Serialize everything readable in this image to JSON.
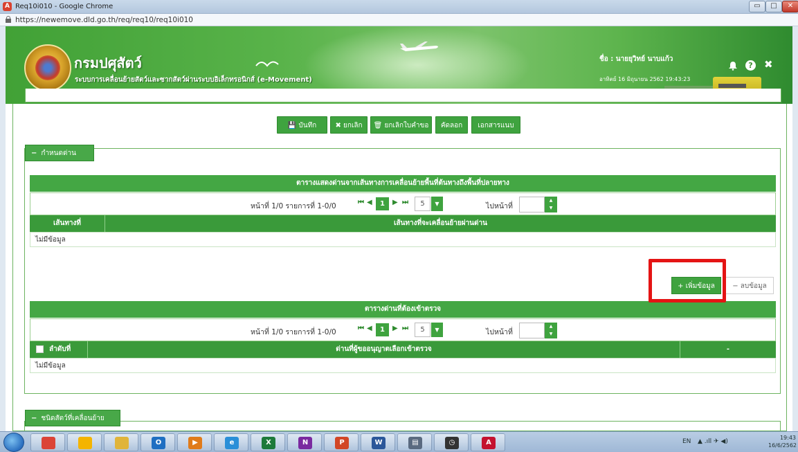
{
  "window": {
    "title": "Req10i010 - Google Chrome",
    "app_icon": "A",
    "controls": {
      "minimize": "▭",
      "maximize": "□",
      "close": "✕"
    }
  },
  "address_bar": {
    "url": "https://newemove.dld.go.th/req/req10/req10i010"
  },
  "header": {
    "title": "กรมปศุสัตว์",
    "subtitle": "ระบบการเคลื่อนย้ายสัตว์และซากสัตว์ผ่านระบบอิเล็กทรอนิกส์ (e-Movement)",
    "user_name": "ชื่อ : นายยุวิทย์ นาบแก้ว",
    "datetime": "อาทิตย์ 16 มิถุนายน 2562 19:43:23",
    "help_label": "?",
    "close_label": "✖"
  },
  "toolbar": {
    "save": "บันทึก",
    "cancel": "ยกเลิก",
    "cancel_request": "ยกเลิกใบคำขอ",
    "copy": "คัดลอก",
    "attachments": "เอกสารแนบ",
    "save_icon": "💾",
    "cancel_icon": "✖",
    "cancel_request_icon": "🗑"
  },
  "section_checkpoint": {
    "legend": "กำหนดด่าน",
    "toggle": "−",
    "table1": {
      "title": "ตารางแสดงด่านจากเส้นทางการเคลื่อนย้ายพื้นที่ต้นทางถึงพื้นที่ปลายทาง",
      "pager_info": "หน้าที่ 1/0 รายการที่ 1-0/0",
      "current_page": "1",
      "page_size": "5",
      "goto_label": "ไปหน้าที่",
      "columns": [
        "เส้นทางที่",
        "เส้นทางที่จะเคลื่อนย้ายผ่านด่าน"
      ],
      "empty": "ไม่มีข้อมูล"
    },
    "add_button": "+ เพิ่มข้อมูล",
    "delete_button": "− ลบข้อมูล",
    "table2": {
      "title": "ตารางด่านที่ต้องเข้าตรวจ",
      "pager_info": "หน้าที่ 1/0 รายการที่ 1-0/0",
      "current_page": "1",
      "page_size": "5",
      "goto_label": "ไปหน้าที่",
      "columns": [
        "ลำดับที่",
        "ด่านที่ผู้ขออนุญาตเลือกเข้าตรวจ",
        "-"
      ],
      "empty": "ไม่มีข้อมูล"
    }
  },
  "section_animal": {
    "legend": "ชนิดสัตว์ที่เคลื่อนย้าย",
    "toggle": "−"
  },
  "pager_icons": {
    "first": "⏮",
    "prev": "◀",
    "next": "▶",
    "last": "⏭",
    "dropdown": "▼"
  },
  "taskbar": {
    "apps": [
      {
        "name": "chrome",
        "label": "",
        "color": "#db4437"
      },
      {
        "name": "chrome-2",
        "label": "",
        "color": "#f4b400"
      },
      {
        "name": "explorer",
        "label": "",
        "color": "#e0b43a"
      },
      {
        "name": "outlook",
        "label": "O",
        "color": "#1f6fc2"
      },
      {
        "name": "media",
        "label": "▶",
        "color": "#e07b1a"
      },
      {
        "name": "ie",
        "label": "e",
        "color": "#2a8fd8"
      },
      {
        "name": "excel",
        "label": "X",
        "color": "#1d7a3a"
      },
      {
        "name": "onenote",
        "label": "N",
        "color": "#7a2aa0"
      },
      {
        "name": "powerpoint",
        "label": "P",
        "color": "#d24726"
      },
      {
        "name": "word",
        "label": "W",
        "color": "#2b579a"
      },
      {
        "name": "printer",
        "label": "▤",
        "color": "#5a6a80"
      },
      {
        "name": "clock",
        "label": "◷",
        "color": "#333"
      },
      {
        "name": "acrobat",
        "label": "A",
        "color": "#c4122f"
      }
    ],
    "lang": "EN",
    "tray": "▲ .ıll ✈ ◀)",
    "time": "19:43",
    "date": "16/6/2562"
  }
}
